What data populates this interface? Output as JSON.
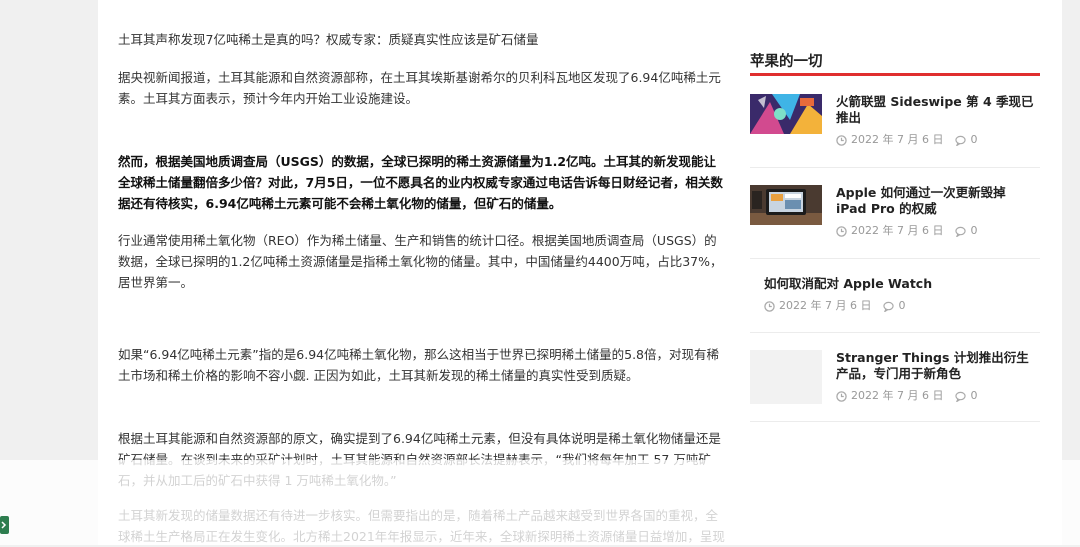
{
  "article": {
    "title": "土耳其声称发现7亿吨稀土是真的吗？权威专家：质疑真实性应该是矿石储量",
    "paragraphs": [
      "据央视新闻报道，土耳其能源和自然资源部称，在土耳其埃斯基谢希尔的贝利科瓦地区发现了6.94亿吨稀土元素。土耳其方面表示，预计今年内开始工业设施建设。",
      "然而，根据美国地质调查局（USGS）的数据，全球已探明的稀土资源储量为1.2亿吨。土耳其的新发现能让全球稀土储量翻倍多少倍？对此，7月5日，一位不愿具名的业内权威专家通过电话告诉每日财经记者，相关数据还有待核实，6.94亿吨稀土元素可能不会稀土氧化物的储量，但矿石的储量。",
      "行业通常使用稀土氧化物（REO）作为稀土储量、生产和销售的统计口径。根据美国地质调查局（USGS）的数据，全球已探明的1.2亿吨稀土资源储量是指稀土氧化物的储量。其中，中国储量约4400万吨，占比37%，居世界第一。",
      "如果“6.94亿吨稀土元素”指的是6.94亿吨稀土氧化物，那么这相当于世界已探明稀土储量的5.8倍，对现有稀土市场和稀土价格的影响不容小觑. 正因为如此，土耳其新发现的稀土储量的真实性受到质疑。",
      "根据土耳其能源和自然资源部的原文，确实提到了6.94亿吨稀土元素，但没有具体说明是稀土氧化物储量还是矿石储量。在谈到未来的采矿计划时，土耳其能源和自然资源部长法提赫表示，“我们将每年加工 57 万吨矿石，并从加工后的矿石中获得 1 万吨稀土氧化物。”",
      "土耳其新发现的储量数据还有待进一步核实。但需要指出的是，随着稀土产品越来越受到世界各国的重视，全球稀土生产格局正在发生变化。北方稀土2021年年报显示，近年来，全球新探明稀土资源储量日益增加，呈现"
    ]
  },
  "sidebar": {
    "title": "苹果的一切",
    "accent_color": "#e02f2f",
    "items": [
      {
        "headline": "火箭联盟 Sideswipe 第 4 季现已推出",
        "date": "2022 年 7 月 6 日",
        "comments": "0",
        "thumb": "game-artwork"
      },
      {
        "headline": "Apple 如何通过一次更新毁掉 iPad Pro 的权威",
        "date": "2022 年 7 月 6 日",
        "comments": "0",
        "thumb": "ipad-photo"
      },
      {
        "headline": "如何取消配对 Apple Watch",
        "date": "2022 年 7 月 6 日",
        "comments": "0",
        "thumb": ""
      },
      {
        "headline": "Stranger Things 计划推出衍生产品，专门用于新角色",
        "date": "2022 年 7 月 6 日",
        "comments": "0",
        "thumb": "placeholder"
      }
    ]
  },
  "icons": {
    "date": "clock-icon",
    "comments": "comment-bubble-icon"
  }
}
